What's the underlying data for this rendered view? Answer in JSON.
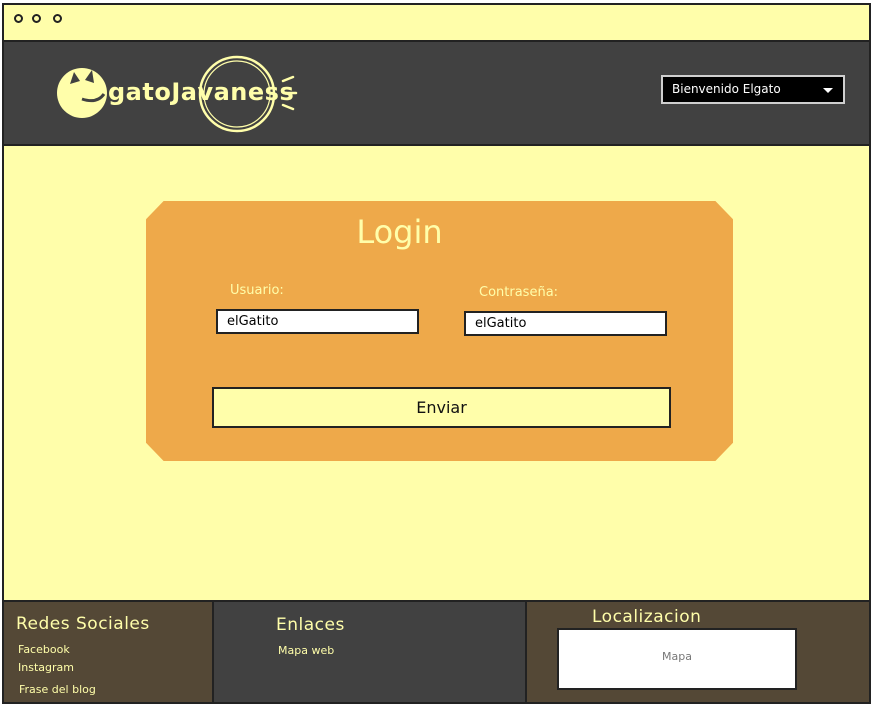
{
  "window": {
    "dots": [
      "window-dot",
      "window-dot",
      "window-dot"
    ]
  },
  "header": {
    "logo_text": "gatoJavaness",
    "user_menu": "Bienvenido Elgato",
    "colors": {
      "bar": "#414141",
      "accent": "#fffeaa"
    }
  },
  "login": {
    "title": "Login",
    "user_label": "Usuario:",
    "user_value": "elGatito",
    "password_label": "Contraseña:",
    "password_value": "elGatito",
    "submit": "Enviar",
    "card_color": "#eea94a"
  },
  "footer": {
    "social": {
      "title": "Redes Sociales",
      "links": [
        "Facebook",
        "Instagram",
        "Frase del blog"
      ]
    },
    "links": {
      "title": "Enlaces",
      "items": [
        "Mapa web"
      ]
    },
    "location": {
      "title": "Localizacion",
      "map_label": "Mapa"
    }
  }
}
